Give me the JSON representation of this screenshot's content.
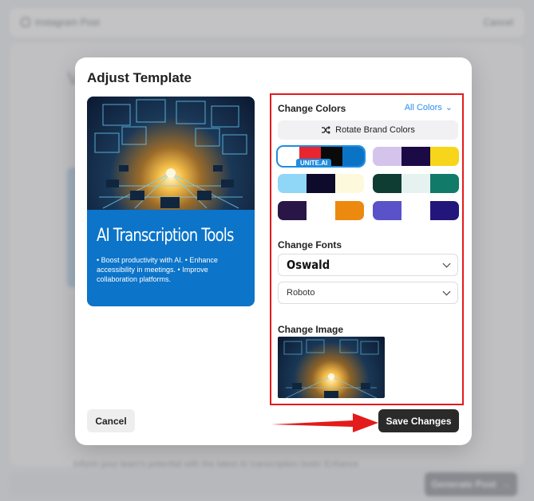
{
  "background": {
    "topbar_title": "Instagram Post",
    "topbar_cancel": "Cancel",
    "heading_fragment": "V",
    "bottom_hint": "Inform your team's potential with the latest AI transcription tools! Enhance",
    "generate_label": "Generate Post",
    "generate_icon": "arrow-right-icon"
  },
  "modal": {
    "title": "Adjust Template",
    "preview": {
      "headline": "AI Transcription Tools",
      "bullets": "• Boost productivity with AI. • Enhance accessibility in meetings. • Improve collaboration platforms.",
      "card_color": "#0c74c9"
    },
    "colors": {
      "label": "Change Colors",
      "all_colors": "All Colors",
      "rotate_label": "Rotate Brand Colors",
      "rotate_icon": "shuffle-icon",
      "selected_badge": "UNITE.AI",
      "palettes": [
        {
          "swatches": [
            "#ffffff",
            "#e8262f",
            "#0a0a0a",
            "#0b73c6"
          ],
          "selected": true
        },
        {
          "swatches": [
            "#d4c4ec",
            "#1b0a45",
            "#f7d51b"
          ],
          "selected": false
        },
        {
          "swatches": [
            "#8fd6f7",
            "#0e0a2b",
            "#fdf9dc"
          ],
          "selected": false
        },
        {
          "swatches": [
            "#0f3d33",
            "#e5f2ef",
            "#127a68"
          ],
          "selected": false
        },
        {
          "swatches": [
            "#2a1646",
            "#ffffff",
            "#ec8a0f"
          ],
          "selected": false
        },
        {
          "swatches": [
            "#5a52c9",
            "#ffffff",
            "#23167a"
          ],
          "selected": false
        }
      ]
    },
    "fonts": {
      "label": "Change Fonts",
      "heading_font": "Oswald",
      "body_font": "Roboto"
    },
    "image": {
      "label": "Change Image"
    },
    "cancel_label": "Cancel",
    "save_label": "Save Changes"
  },
  "accent": {
    "highlight": "#e31b1b",
    "link": "#2b8ef0",
    "primary_button": "#2a2a2a"
  }
}
